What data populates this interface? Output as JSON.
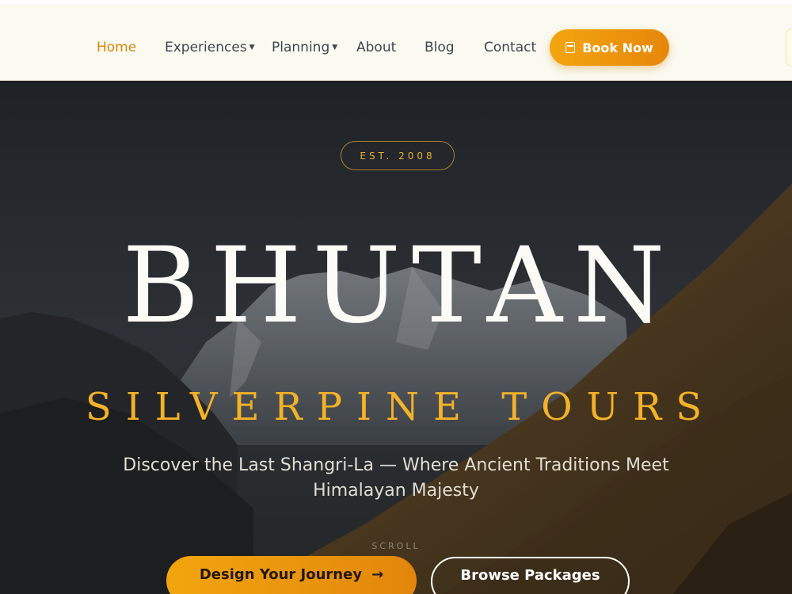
{
  "nav": {
    "items": [
      {
        "label": "Home",
        "active": true
      },
      {
        "label": "Experiences",
        "dropdown": true
      },
      {
        "label": "Planning",
        "dropdown": true
      },
      {
        "label": "About"
      },
      {
        "label": "Blog"
      },
      {
        "label": "Contact"
      }
    ],
    "book_label": "Book Now",
    "book_icon": "calendar-icon"
  },
  "hero": {
    "badge": "EST. 2008",
    "title": "BHUTAN",
    "subtitle": "SILVERPINE TOURS",
    "tagline": "Discover the Last Shangri-La — Where Ancient Traditions Meet Himalayan Majesty",
    "scroll_label": "SCROLL",
    "primary_button": "Design Your Journey",
    "primary_icon": "arrow-right-icon",
    "secondary_button": "Browse Packages"
  },
  "colors": {
    "accent": "#e8940c",
    "nav_bg": "#fbfaf0",
    "gold_text": "#f4b229"
  }
}
